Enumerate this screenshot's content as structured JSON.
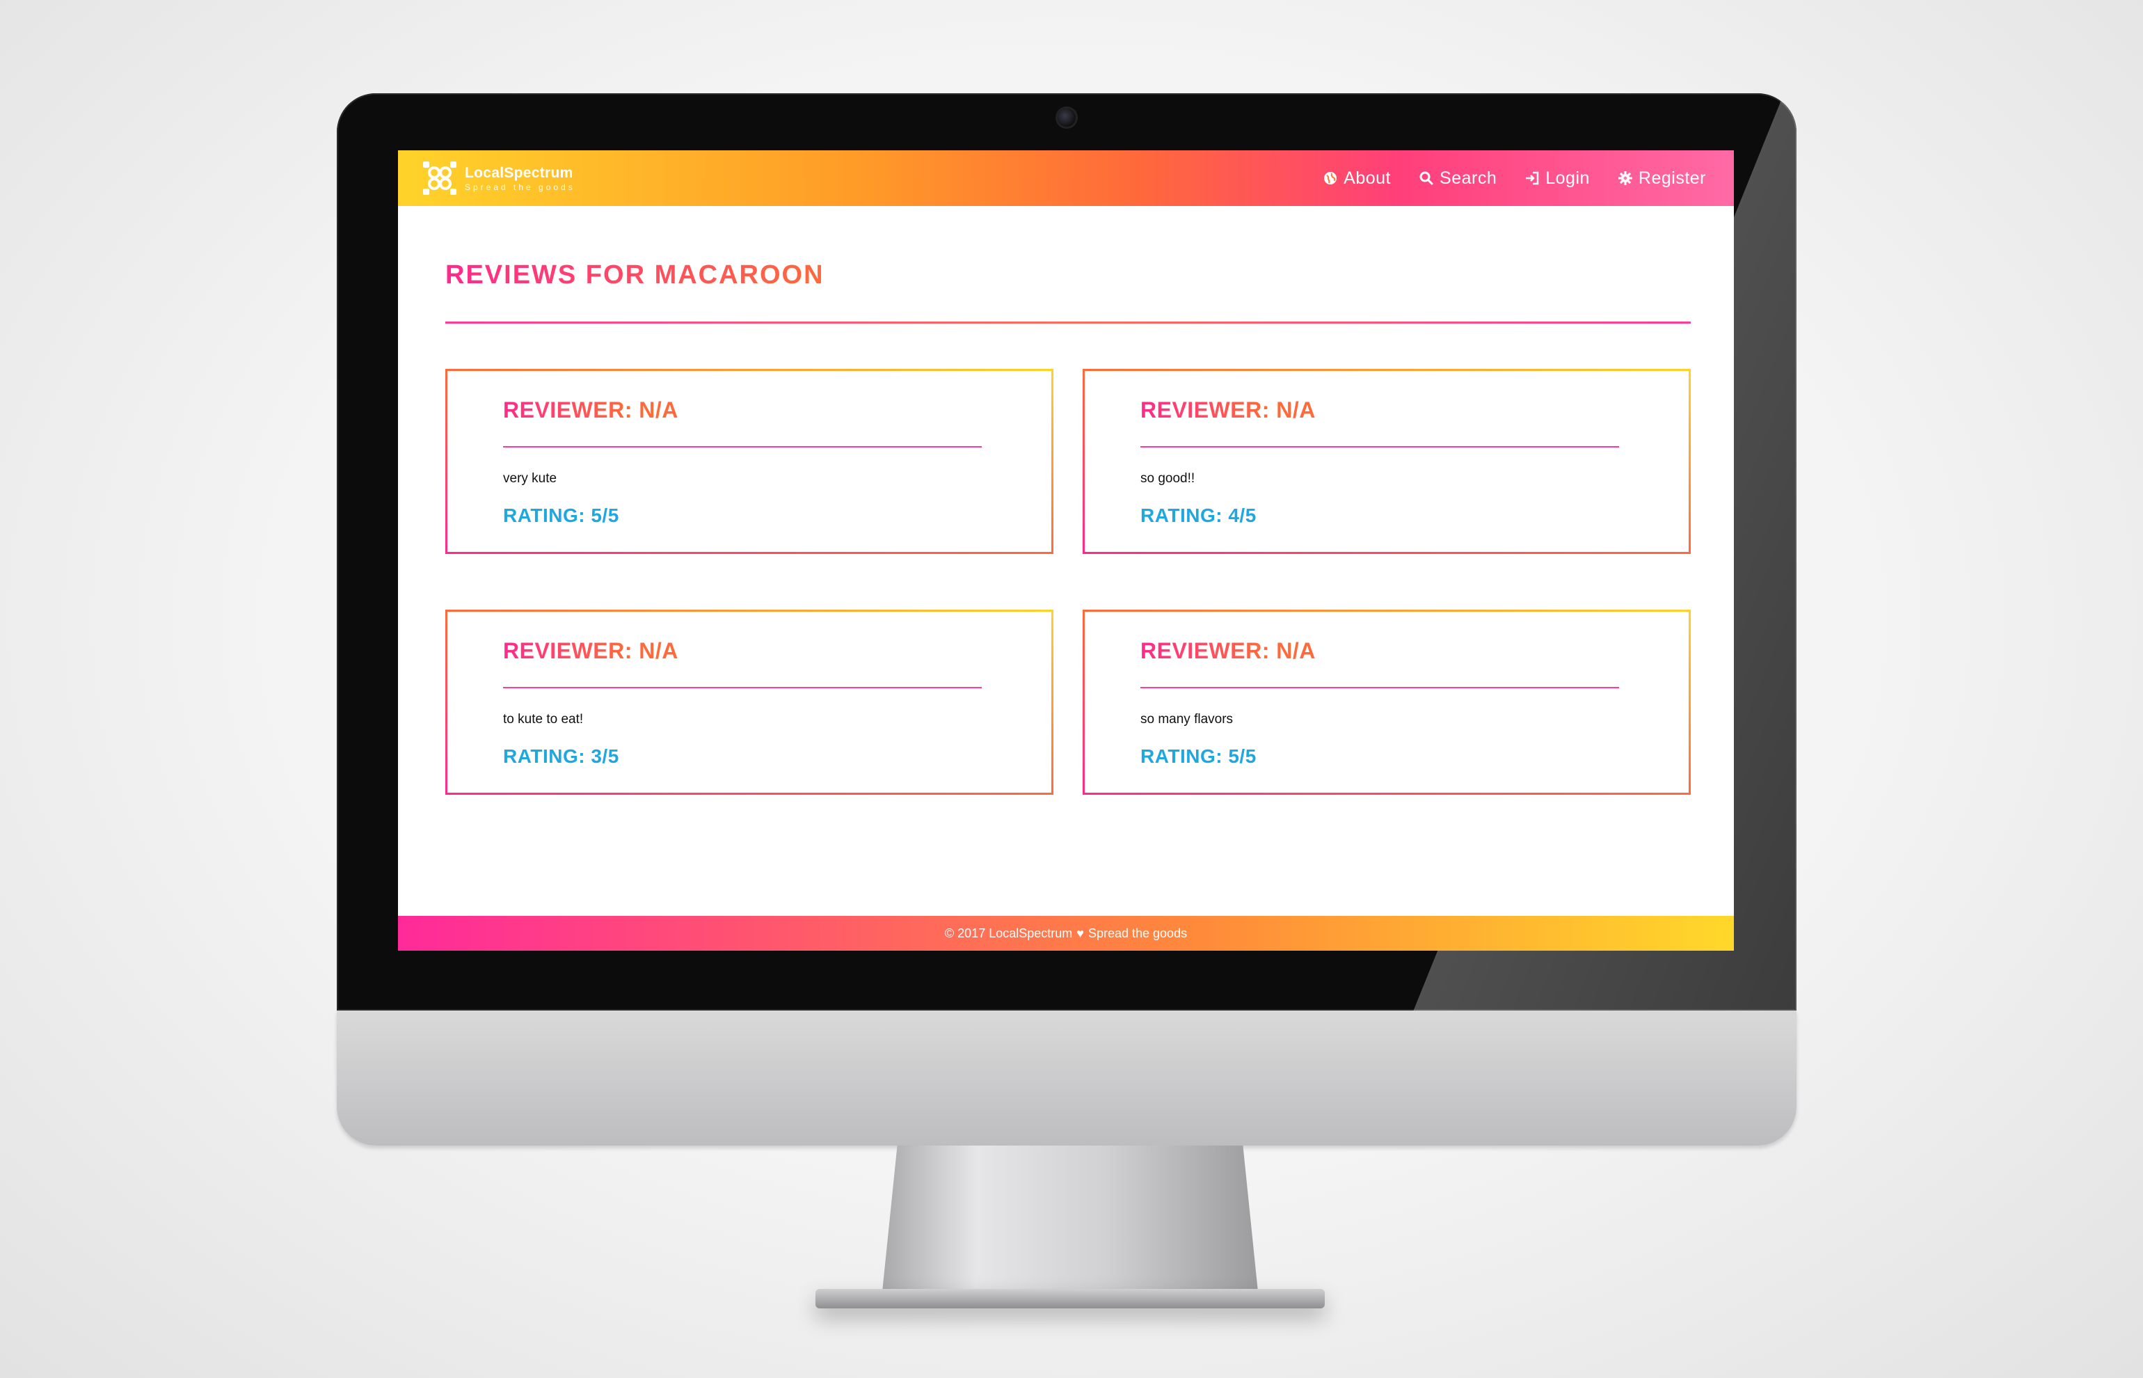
{
  "nav": {
    "brand_name": "LocalSpectrum",
    "brand_tagline": "Spread the goods",
    "links": [
      {
        "label": "About",
        "icon": "globe-icon"
      },
      {
        "label": "Search",
        "icon": "search-icon"
      },
      {
        "label": "Login",
        "icon": "login-icon"
      },
      {
        "label": "Register",
        "icon": "gear-icon"
      }
    ]
  },
  "page": {
    "title": "REVIEWS FOR MACAROON"
  },
  "reviews": [
    {
      "reviewer": "REVIEWER: N/A",
      "comment": "very kute",
      "rating": "RATING: 5/5"
    },
    {
      "reviewer": "REVIEWER: N/A",
      "comment": "so good!!",
      "rating": "RATING: 4/5"
    },
    {
      "reviewer": "REVIEWER: N/A",
      "comment": "to kute to eat!",
      "rating": "RATING: 3/5"
    },
    {
      "reviewer": "REVIEWER: N/A",
      "comment": "so many flavors",
      "rating": "RATING: 5/5"
    }
  ],
  "footer": {
    "left": "© 2017 LocalSpectrum",
    "icon": "heart-icon",
    "right": "Spread the goods"
  },
  "colors": {
    "accent_pink": "#ff2a8c",
    "accent_orange": "#ff6a3a",
    "accent_yellow": "#ffd32a",
    "rating_blue": "#1ea7e0"
  }
}
